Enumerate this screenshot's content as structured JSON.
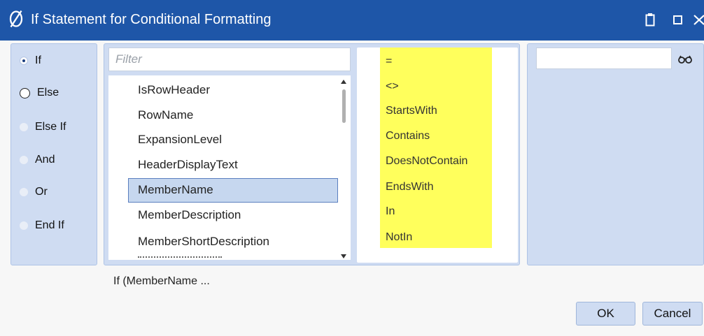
{
  "dialog": {
    "title": "If Statement for Conditional Formatting",
    "accent_color": "#1e56a8",
    "icons": [
      "app-logo-icon",
      "clipboard-icon",
      "maximize-icon",
      "close-icon"
    ]
  },
  "conditions": {
    "options": [
      {
        "label": "If",
        "state": "checked"
      },
      {
        "label": "Else",
        "state": "unchecked"
      },
      {
        "label": "Else If",
        "state": "disabled"
      },
      {
        "label": "And",
        "state": "disabled"
      },
      {
        "label": "Or",
        "state": "disabled"
      },
      {
        "label": "End If",
        "state": "disabled"
      }
    ]
  },
  "fields": {
    "filter_placeholder": "Filter",
    "filter_value": "",
    "items": [
      "IsRowHeader",
      "RowName",
      "ExpansionLevel",
      "HeaderDisplayText",
      "MemberName",
      "MemberDescription",
      "MemberShortDescription"
    ],
    "selected": "MemberName"
  },
  "operators": {
    "items": [
      "=",
      "<>",
      "StartsWith",
      "Contains",
      "DoesNotContain",
      "EndsWith",
      "In",
      "NotIn"
    ],
    "highlight_color": "#ffff5c"
  },
  "value": {
    "input_value": "",
    "lookup_icon": "glasses-icon"
  },
  "expression_preview": "If (MemberName ...",
  "buttons": {
    "ok_label": "OK",
    "cancel_label": "Cancel"
  }
}
